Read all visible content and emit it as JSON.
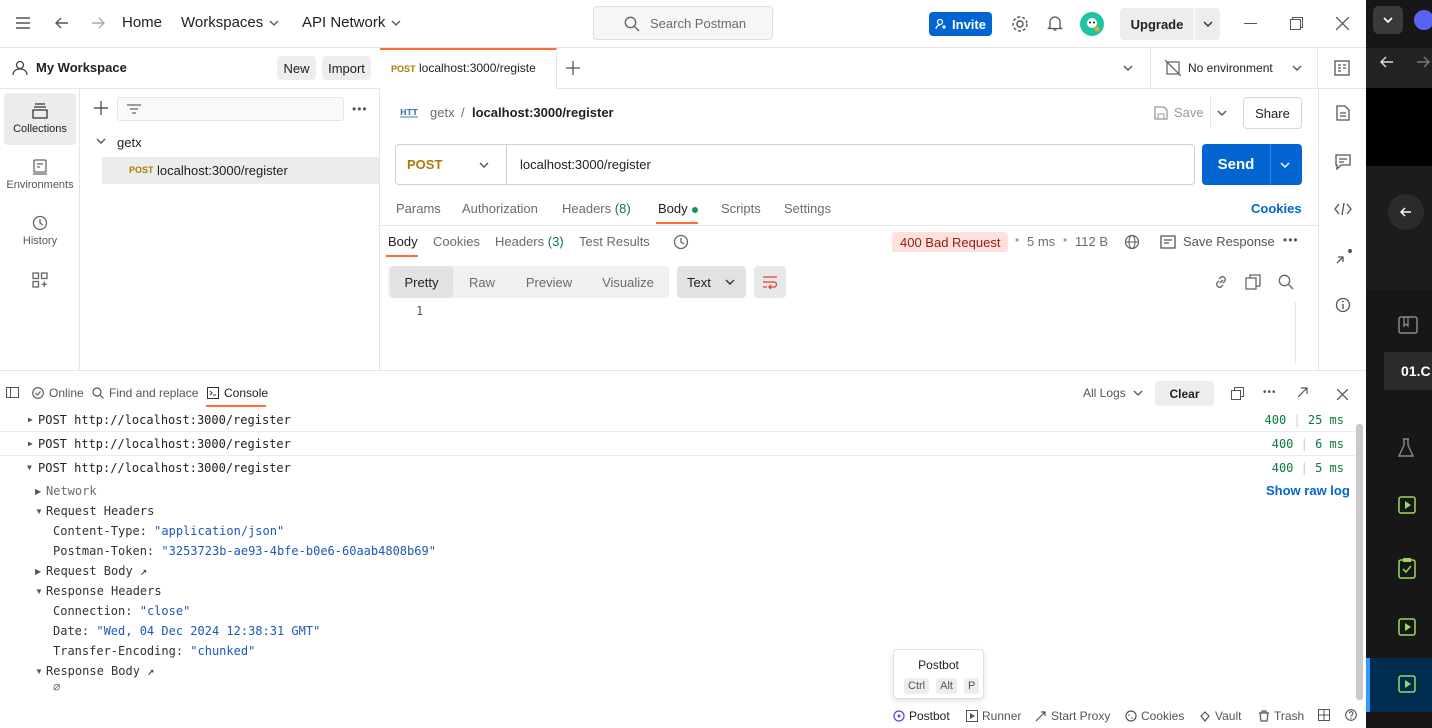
{
  "topbar": {
    "home": "Home",
    "workspaces": "Workspaces",
    "api_network": "API Network",
    "search_placeholder": "Search Postman",
    "invite": "Invite",
    "upgrade": "Upgrade"
  },
  "sidebar": {
    "workspace_name": "My Workspace",
    "new_label": "New",
    "import_label": "Import",
    "nav": [
      {
        "label": "Collections",
        "icon": "collections-icon"
      },
      {
        "label": "Environments",
        "icon": "environments-icon"
      },
      {
        "label": "History",
        "icon": "history-icon"
      },
      {
        "label": "",
        "icon": "apps-icon"
      }
    ],
    "tree": {
      "collection": "getx",
      "request_method": "POST",
      "request_name": "localhost:3000/register"
    }
  },
  "tabs": {
    "active_method": "POST",
    "active_title": "localhost:3000/registe",
    "environment": "No environment"
  },
  "request": {
    "breadcrumb_parent": "getx",
    "breadcrumb_sep": "/",
    "breadcrumb_current": "localhost:3000/register",
    "save_label": "Save",
    "share_label": "Share",
    "method": "POST",
    "url": "localhost:3000/register",
    "send_label": "Send",
    "tabs": [
      "Params",
      "Authorization",
      "Headers",
      "(8)",
      "Body",
      "Scripts",
      "Settings"
    ],
    "cookies_label": "Cookies"
  },
  "response": {
    "tabs": [
      "Body",
      "Cookies",
      "Headers",
      "(3)",
      "Test Results"
    ],
    "status": "400 Bad Request",
    "time": "5 ms",
    "size": "112 B",
    "save_response": "Save Response",
    "formats": [
      "Pretty",
      "Raw",
      "Preview",
      "Visualize"
    ],
    "language": "Text",
    "line_number": "1"
  },
  "console": {
    "online": "Online",
    "find_replace": "Find and replace",
    "console_label": "Console",
    "all_logs": "All Logs",
    "clear": "Clear",
    "logs": [
      {
        "text": "POST http://localhost:3000/register",
        "status": "400",
        "time": "25 ms"
      },
      {
        "text": "POST http://localhost:3000/register",
        "status": "400",
        "time": "6 ms"
      },
      {
        "text": "POST http://localhost:3000/register",
        "status": "400",
        "time": "5 ms"
      }
    ],
    "details": {
      "network": "Network",
      "show_raw_log": "Show raw log",
      "request_headers": "Request Headers",
      "content_type_key": "Content-Type:",
      "content_type_val": "\"application/json\"",
      "postman_token_key": "Postman-Token:",
      "postman_token_val": "\"3253723b-ae93-4bfe-b0e6-60aab4808b69\"",
      "request_body": "Request Body",
      "response_headers": "Response Headers",
      "connection_key": "Connection:",
      "connection_val": "\"close\"",
      "date_key": "Date:",
      "date_val": "\"Wed, 04 Dec 2024 12:38:31 GMT\"",
      "transfer_key": "Transfer-Encoding:",
      "transfer_val": "\"chunked\"",
      "response_body": "Response Body",
      "empty": "∅"
    }
  },
  "postbot_tooltip": {
    "title": "Postbot",
    "keys": [
      "Ctrl",
      "Alt",
      "P"
    ]
  },
  "statusbar": {
    "postbot": "Postbot",
    "runner": "Runner",
    "start_proxy": "Start Proxy",
    "cookies": "Cookies",
    "vault": "Vault",
    "trash": "Trash"
  },
  "dark_panel": {
    "fragment": "01.C"
  },
  "colors": {
    "accent_blue": "#0265d2",
    "post_orange": "#ad7a03",
    "status_green": "#0b7a3e",
    "error_bg": "#ffe0dc",
    "error_text": "#8f1d12",
    "tab_underline": "#ff6c37"
  }
}
